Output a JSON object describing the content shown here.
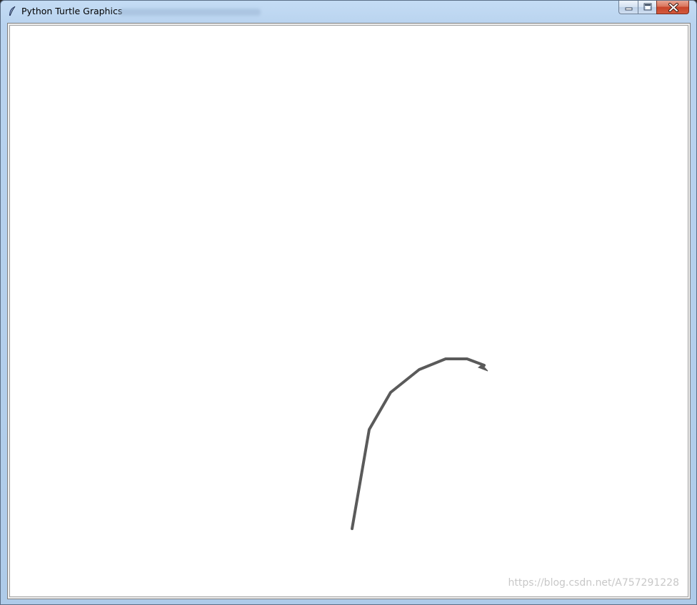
{
  "window": {
    "title": "Python Turtle Graphics",
    "icon": "feather-icon"
  },
  "controls": {
    "minimize_icon": "minimize-icon",
    "maximize_icon": "maximize-icon",
    "close_icon": "close-icon"
  },
  "canvas": {
    "background": "#ffffff",
    "pen_color": "#5a5a5a"
  },
  "watermark": {
    "text": "https://blog.csdn.net/A757291228"
  }
}
